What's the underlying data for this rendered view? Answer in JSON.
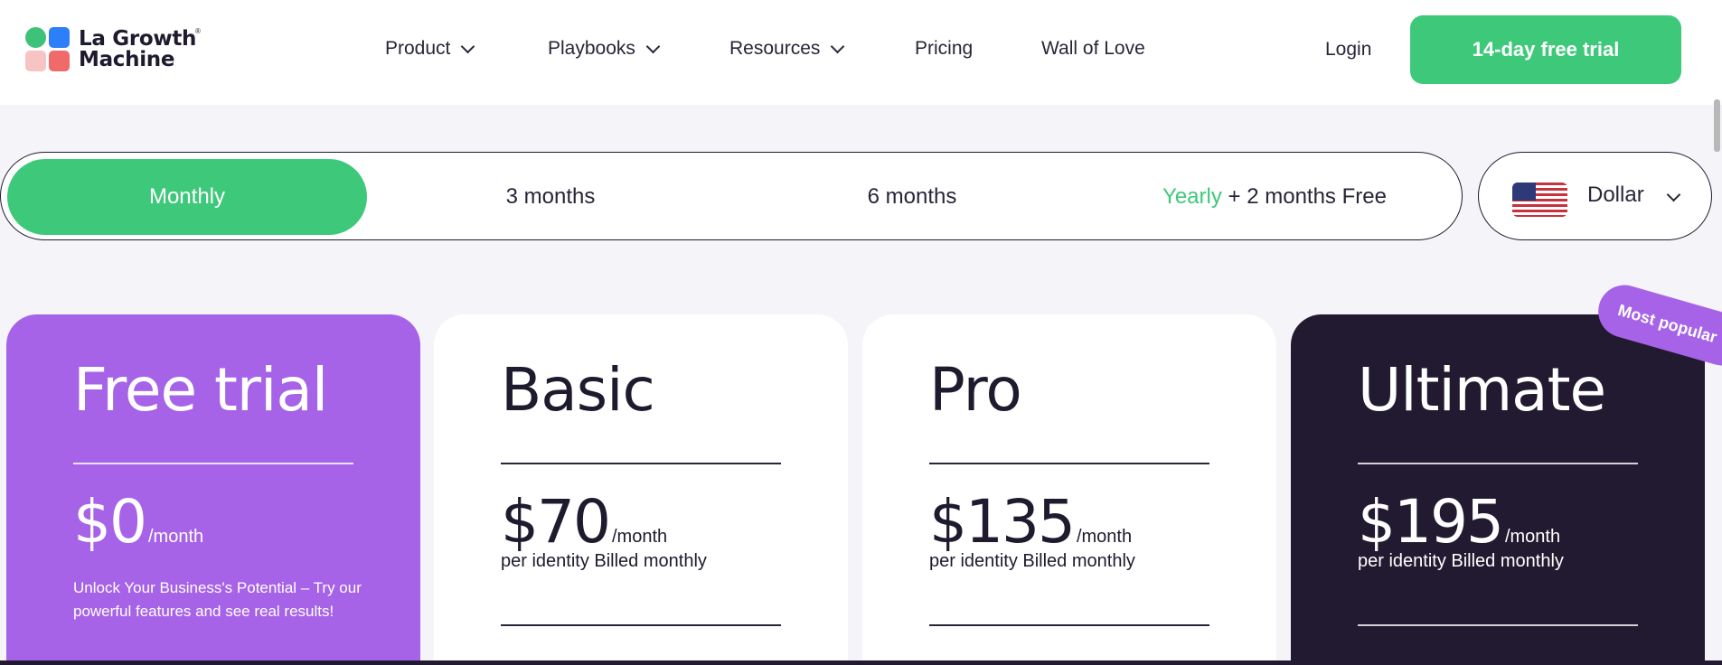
{
  "brand": {
    "name_line1": "La Growth",
    "name_line2": "Machine",
    "registered": "®"
  },
  "nav": {
    "items": [
      {
        "label": "Product",
        "dropdown": true
      },
      {
        "label": "Playbooks",
        "dropdown": true
      },
      {
        "label": "Resources",
        "dropdown": true
      },
      {
        "label": "Pricing",
        "dropdown": false
      },
      {
        "label": "Wall of Love",
        "dropdown": false
      }
    ],
    "login": "Login",
    "cta": "14-day free trial"
  },
  "billing": {
    "options": [
      "Monthly",
      "3 months",
      "6 months"
    ],
    "yearly_word": "Yearly",
    "yearly_suffix": " + 2 months Free",
    "selected": "Monthly"
  },
  "currency": {
    "label": "Dollar",
    "flag": "us-flag-icon"
  },
  "plans": [
    {
      "name": "Free trial",
      "price": "$0",
      "period": "/month",
      "description": "Unlock Your Business's Potential – Try our powerful features and see real results!"
    },
    {
      "name": "Basic",
      "price": "$70",
      "period": "/month",
      "billed": "per identity Billed monthly"
    },
    {
      "name": "Pro",
      "price": "$135",
      "period": "/month",
      "billed": "per identity Billed monthly"
    },
    {
      "name": "Ultimate",
      "price": "$195",
      "period": "/month",
      "billed": "per identity Billed monthly",
      "badge": "Most popular"
    }
  ],
  "colors": {
    "accent_green": "#3ec97a",
    "purple": "#a663e8",
    "dark": "#221a30"
  }
}
